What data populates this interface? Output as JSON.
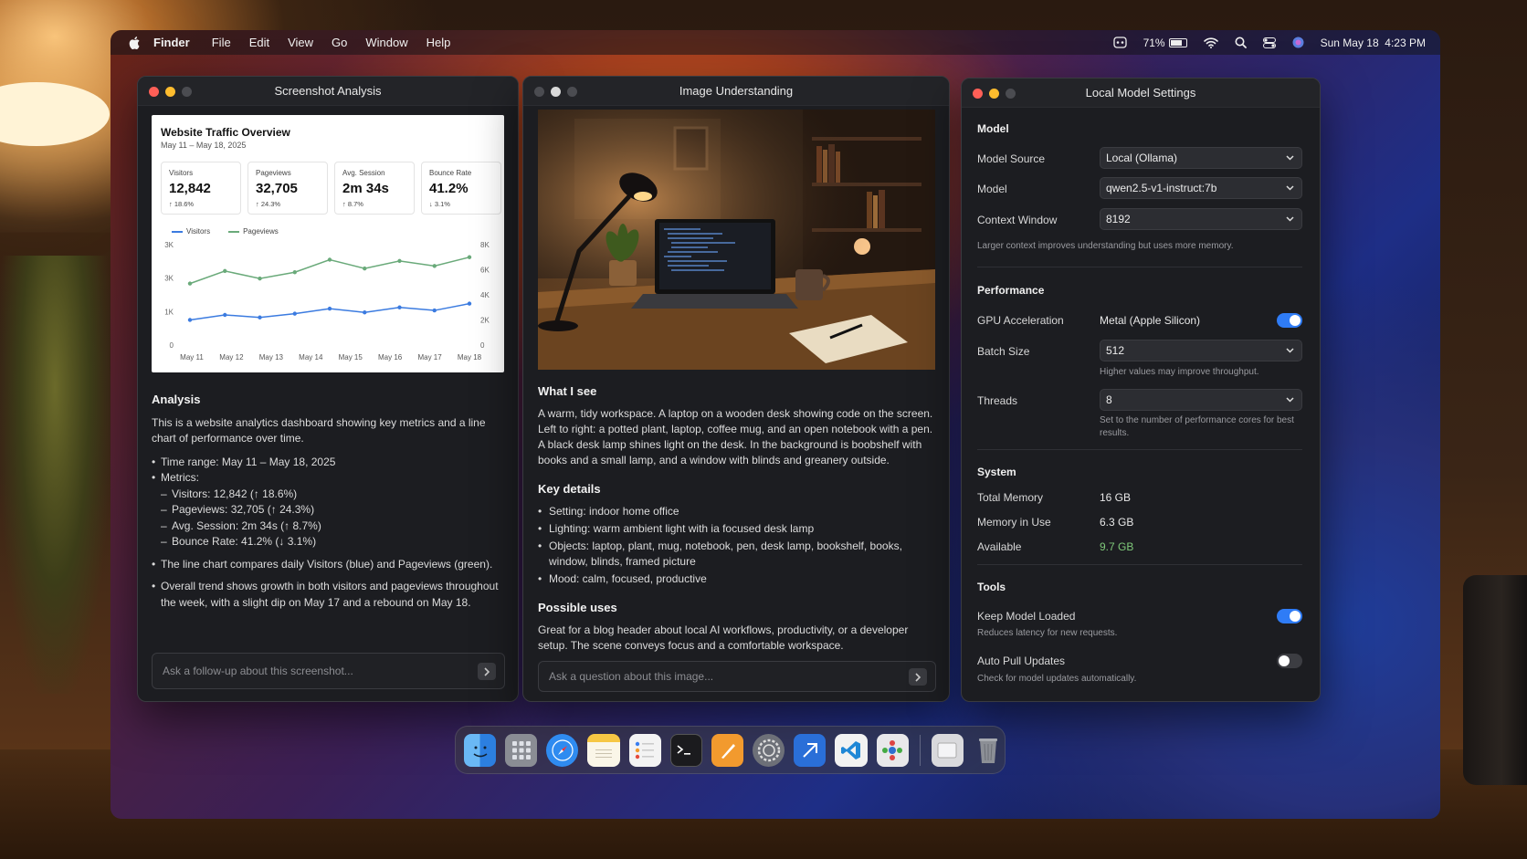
{
  "menubar": {
    "app": "Finder",
    "items": [
      "File",
      "Edit",
      "View",
      "Go",
      "Window",
      "Help"
    ],
    "battery": "71%",
    "battery_level": 0.71,
    "datetime": "Sun May 18  4:23 PM"
  },
  "w1": {
    "title": "Screenshot Analysis",
    "dashboard": {
      "title": "Website Traffic Overview",
      "subtitle": "May 11 – May 18, 2025",
      "cards": [
        {
          "label": "Visitors",
          "value": "12,842",
          "delta": "↑ 18.6%"
        },
        {
          "label": "Pageviews",
          "value": "32,705",
          "delta": "↑ 24.3%"
        },
        {
          "label": "Avg. Session",
          "value": "2m 34s",
          "delta": "↑ 8.7%"
        },
        {
          "label": "Bounce Rate",
          "value": "41.2%",
          "delta": "↓ 3.1%"
        }
      ]
    },
    "analysis": {
      "heading": "Analysis",
      "intro": "This is a website analytics dashboard showing key metrics and a line chart of performance over time.",
      "bullets": [
        {
          "text": "Time range: May 11 – May 18, 2025",
          "type": "main"
        },
        {
          "text": "Metrics:",
          "type": "main"
        },
        {
          "text": "Visitors: 12,842 (↑ 18.6%)",
          "type": "sub"
        },
        {
          "text": "Pageviews: 32,705 (↑ 24.3%)",
          "type": "sub"
        },
        {
          "text": "Avg. Session: 2m 34s (↑ 8.7%)",
          "type": "sub"
        },
        {
          "text": "Bounce Rate: 41.2% (↓ 3.1%)",
          "type": "sub"
        },
        {
          "text": "The line chart compares daily Visitors (blue) and Pageviews (green).",
          "type": "gap"
        },
        {
          "text": "Overall trend shows growth in both visitors and pageviews throughout the week, with a slight dip on May 17 and a rebound on May 18.",
          "type": "gap"
        }
      ]
    },
    "input_placeholder": "Ask a follow-up about this screenshot..."
  },
  "chart_data": {
    "type": "line",
    "categories": [
      "May 11",
      "May 12",
      "May 13",
      "May 14",
      "May 15",
      "May 16",
      "May 17",
      "May 18"
    ],
    "series": [
      {
        "name": "Visitors",
        "color": "#3b7be0",
        "axis": "left",
        "values": [
          1000,
          1200,
          1100,
          1250,
          1450,
          1300,
          1500,
          1380,
          1650
        ]
      },
      {
        "name": "Pageviews",
        "color": "#6aaa7a",
        "axis": "right",
        "values": [
          4900,
          5900,
          5300,
          5800,
          6800,
          6100,
          6700,
          6300,
          7000
        ]
      }
    ],
    "left_ticks": [
      "3K",
      "3K",
      "1K",
      "0"
    ],
    "right_ticks": [
      "8K",
      "6K",
      "4K",
      "2K",
      "0"
    ],
    "ylim_left": [
      0,
      4000
    ],
    "ylim_right": [
      0,
      8000
    ],
    "grid": false,
    "legend": "top-left"
  },
  "w2": {
    "title": "Image Understanding",
    "sections": [
      {
        "heading": "What I see",
        "body": "A warm, tidy workspace. A laptop on a wooden desk showing code on the screen. Left to right: a potted plant, laptop, coffee mug, and an open notebook with a pen. A black desk lamp shines light on the desk. In the background is boobshelf with books and a small lamp, and a window with blinds and greanery outside."
      }
    ],
    "key_details_heading": "Key details",
    "key_details": [
      "Setting: indoor home office",
      "Lighting: warm ambient light with ia focused desk lamp",
      "Objects: laptop, plant, mug, notebook, pen, desk lamp, bookshelf, books, window, blinds, framed picture",
      "Mood: calm, focused, productive"
    ],
    "uses_heading": "Possible uses",
    "uses_body": "Great for a blog header about local AI workflows, productivity, or a developer setup. The scene conveys focus and a comfortable workspace.",
    "input_placeholder": "Ask a question about this image..."
  },
  "w3": {
    "title": "Local Model Settings",
    "model_heading": "Model",
    "model_source_label": "Model Source",
    "model_source_value": "Local (Ollama)",
    "model_label": "Model",
    "model_value": "qwen2.5-v1-instruct:7b",
    "context_label": "Context Window",
    "context_value": "8192",
    "context_hint": "Larger context improves understanding but uses more memory.",
    "perf_heading": "Performance",
    "gpu_label": "GPU Acceleration",
    "gpu_value": "Metal (Apple Silicon)",
    "gpu_on": true,
    "batch_label": "Batch Size",
    "batch_value": "512",
    "batch_hint": "Higher values may improve throughput.",
    "threads_label": "Threads",
    "threads_value": "8",
    "threads_hint": "Set to the number of performance cores for best results.",
    "system_heading": "System",
    "total_mem_label": "Total Memory",
    "total_mem_value": "16 GB",
    "mem_use_label": "Memory in Use",
    "mem_use_value": "6.3 GB",
    "available_label": "Available",
    "available_value": "9.7 GB",
    "available_color": "#7fc97a",
    "tools_heading": "Tools",
    "keep_loaded_label": "Keep Model Loaded",
    "keep_loaded_hint": "Reduces latency for new requests.",
    "keep_loaded_on": true,
    "auto_pull_label": "Auto Pull Updates",
    "auto_pull_hint": "Check for model updates automatically.",
    "auto_pull_on": false
  },
  "dock": {
    "icons": [
      "finder-icon",
      "launchpad-icon",
      "safari-icon",
      "notes-icon",
      "reminders-icon",
      "terminal-icon",
      "pages-icon",
      "system-settings-icon",
      "xcode-icon",
      "vscode-icon",
      "ollama-icon",
      "downloads-icon",
      "trash-icon"
    ]
  },
  "colors": {
    "accent": "#2f7cf6",
    "window_bg": "#1c1d21"
  }
}
